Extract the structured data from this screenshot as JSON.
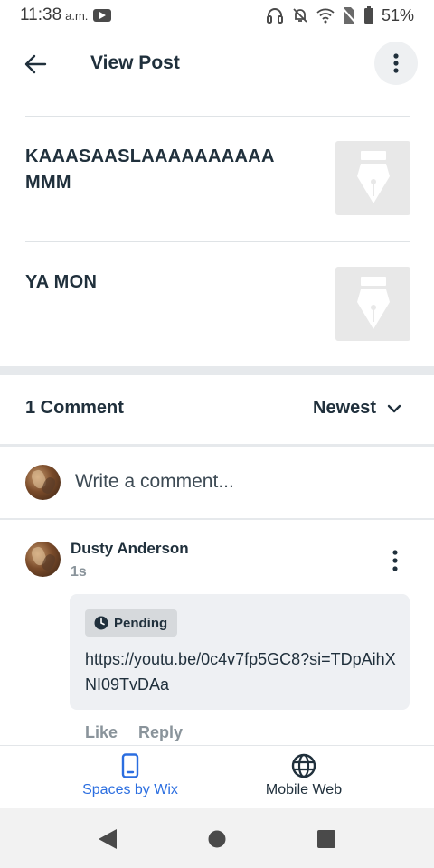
{
  "status_bar": {
    "time": "11:38",
    "ampm": "a.m.",
    "battery": "51%",
    "icons": [
      "youtube-icon",
      "headphones-icon",
      "bell-off-icon",
      "wifi-icon",
      "no-sim-icon",
      "battery-icon"
    ]
  },
  "app_bar": {
    "title": "View Post",
    "back_icon": "arrow-left-icon",
    "more_icon": "more-vertical-icon"
  },
  "posts": [
    {
      "title": "KAAASAASLAAAAAAAAAA MMM",
      "thumb_icon": "pen-nib-icon"
    },
    {
      "title": "YA MON",
      "thumb_icon": "pen-nib-icon"
    }
  ],
  "comments": {
    "count_label": "1 Comment",
    "sort_label": "Newest",
    "write_placeholder": "Write a comment...",
    "items": [
      {
        "author": "Dusty Anderson",
        "time": "1s",
        "status": "Pending",
        "text": "https://youtu.be/0c4v7fp5GC8?si=TDpAihXNI09TvDAa",
        "like_label": "Like",
        "reply_label": "Reply"
      }
    ]
  },
  "bottom_nav": {
    "tabs": [
      {
        "label": "Spaces by Wix",
        "icon": "phone-icon",
        "active": true
      },
      {
        "label": "Mobile Web",
        "icon": "globe-icon",
        "active": false
      }
    ]
  },
  "colors": {
    "accent": "#2b6ee0",
    "text_primary": "#20303c",
    "text_muted": "#8a949b",
    "comment_bg": "#eef0f3"
  }
}
